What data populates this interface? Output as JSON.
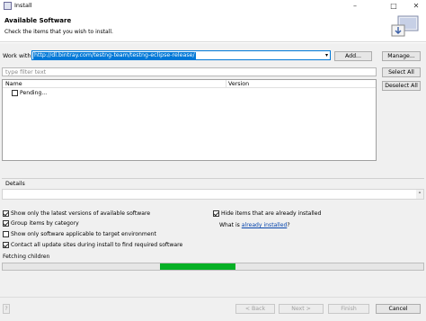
{
  "window": {
    "title": "Install"
  },
  "header": {
    "title": "Available Software",
    "subtitle": "Check the items that you wish to install."
  },
  "work_with": {
    "label": "Work with:",
    "value": "http://dl.bintray.com/testng-team/testng-eclipse-release/",
    "add_label": "Add...",
    "manage_label": "Manage..."
  },
  "filter": {
    "placeholder": "type filter text"
  },
  "buttons": {
    "select_all": "Select All",
    "deselect_all": "Deselect All"
  },
  "tree": {
    "columns": [
      "Name",
      "Version"
    ],
    "items": [
      {
        "label": "Pending...",
        "checked": false
      }
    ]
  },
  "details": {
    "label": "Details"
  },
  "options": {
    "latest_versions": {
      "label": "Show only the latest versions of available software",
      "checked": true
    },
    "group_by_category": {
      "label": "Group items by category",
      "checked": true
    },
    "applicable_only": {
      "label": "Show only software applicable to target environment",
      "checked": false
    },
    "contact_sites": {
      "label": "Contact all update sites during install to find required software",
      "checked": true
    },
    "hide_installed": {
      "label": "Hide items that are already installed",
      "checked": true
    },
    "what_is_prefix": "What is ",
    "already_installed_link": "already installed",
    "what_is_suffix": "?"
  },
  "progress": {
    "label": "Fetching children",
    "fill": 0.18
  },
  "footer": {
    "back": "< Back",
    "next": "Next >",
    "finish": "Finish",
    "cancel": "Cancel"
  },
  "colors": {
    "progress_green": "#06b025",
    "selection_blue": "#0078d7"
  },
  "icons": {
    "title": "install-icon",
    "wizard": "install-wizard-icon"
  }
}
